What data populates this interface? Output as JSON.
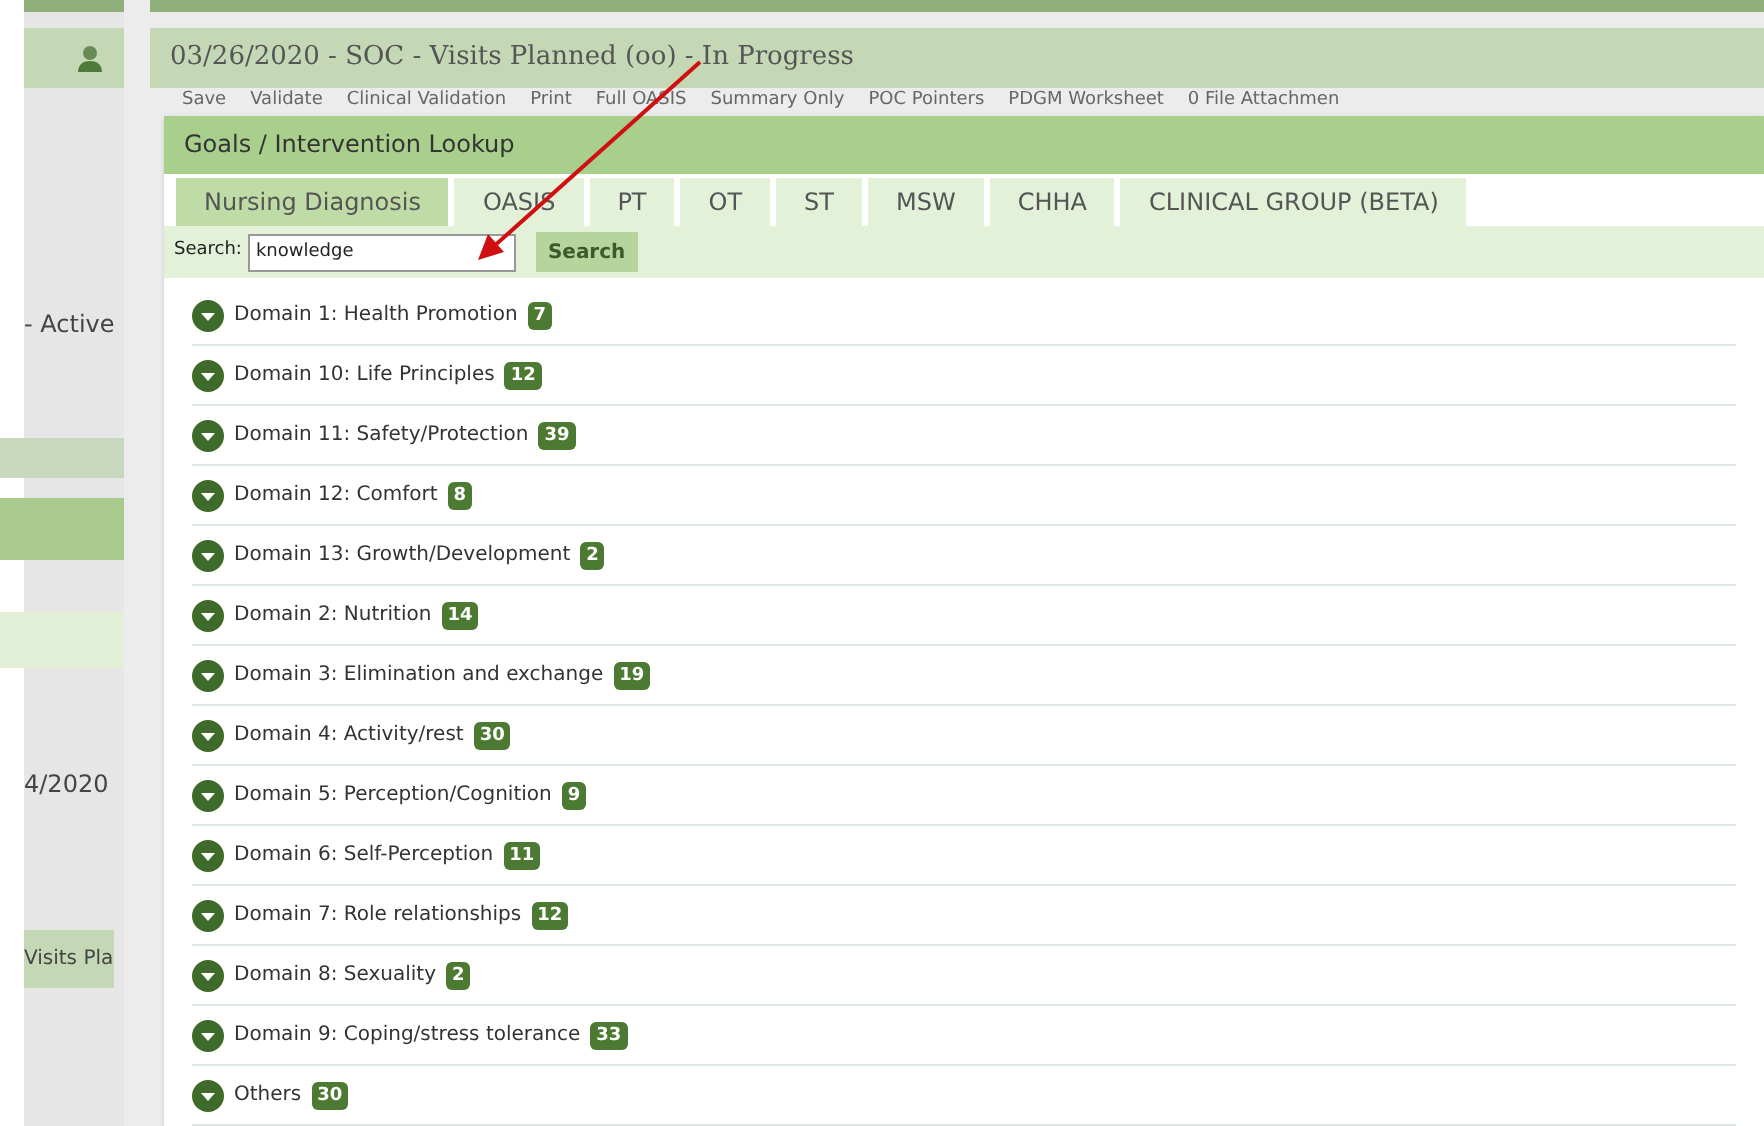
{
  "sidebar": {
    "items": [
      {
        "kind": "text",
        "label": "- Active"
      },
      {
        "kind": "band"
      },
      {
        "kind": "text",
        "label": "4/2020"
      },
      {
        "kind": "tag",
        "label": "Visits Pla"
      }
    ]
  },
  "header": {
    "title": "03/26/2020 - SOC - Visits Planned (oo) - In Progress"
  },
  "toolbar": [
    "Save",
    "Validate",
    "Clinical Validation",
    "Print",
    "Full OASIS",
    "Summary Only",
    "POC Pointers",
    "PDGM Worksheet",
    "0 File Attachmen"
  ],
  "dialog": {
    "title": "Goals / Intervention Lookup",
    "tabs": [
      {
        "label": "Nursing Diagnosis",
        "selected": true
      },
      {
        "label": "OASIS",
        "selected": false
      },
      {
        "label": "PT",
        "selected": false
      },
      {
        "label": "OT",
        "selected": false
      },
      {
        "label": "ST",
        "selected": false
      },
      {
        "label": "MSW",
        "selected": false
      },
      {
        "label": "CHHA",
        "selected": false
      },
      {
        "label": "CLINICAL GROUP (BETA)",
        "selected": false
      }
    ],
    "search": {
      "label": "Search:",
      "value": "knowledge",
      "button": "Search"
    },
    "domains": [
      {
        "label": "Domain 1: Health Promotion",
        "count": "7"
      },
      {
        "label": "Domain 10: Life Principles",
        "count": "12"
      },
      {
        "label": "Domain 11: Safety/Protection",
        "count": "39"
      },
      {
        "label": "Domain 12: Comfort",
        "count": "8"
      },
      {
        "label": "Domain 13: Growth/Development",
        "count": "2"
      },
      {
        "label": "Domain 2: Nutrition",
        "count": "14"
      },
      {
        "label": "Domain 3: Elimination and exchange",
        "count": "19"
      },
      {
        "label": "Domain 4: Activity/rest",
        "count": "30"
      },
      {
        "label": "Domain 5: Perception/Cognition",
        "count": "9"
      },
      {
        "label": "Domain 6: Self-Perception",
        "count": "11"
      },
      {
        "label": "Domain 7: Role relationships",
        "count": "12"
      },
      {
        "label": "Domain 8: Sexuality",
        "count": "2"
      },
      {
        "label": "Domain 9: Coping/stress tolerance",
        "count": "33"
      },
      {
        "label": "Others",
        "count": "30"
      }
    ]
  }
}
